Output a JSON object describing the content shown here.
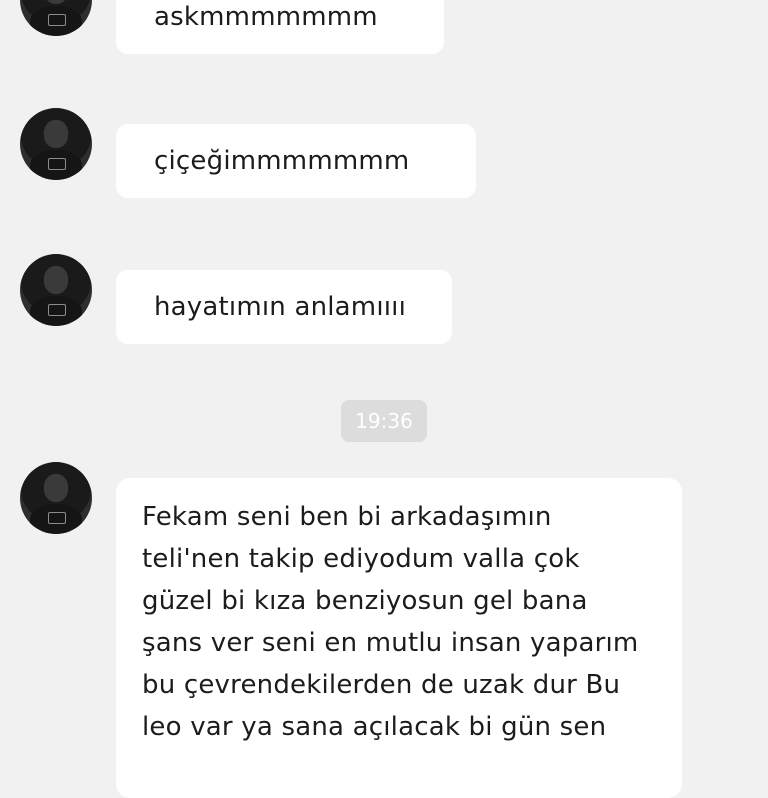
{
  "messages": [
    {
      "text": "askmmmmmmm"
    },
    {
      "text": "çiçeğimmmmmmm"
    },
    {
      "text": "hayatımın anlamıııı"
    },
    {
      "text": "Fekam seni ben bi arkadaşımın\nteli'nen takip ediyodum valla çok\ngüzel bi kıza benziyosun gel bana\nşans ver seni en mutlu insan yaparım\nbu çevrendekilerden de uzak dur Bu\nleo var ya sana açılacak bi gün sen"
    }
  ],
  "timestamp": "19:36",
  "colors": {
    "background": "#f1f1f1",
    "bubble": "#ffffff",
    "timestamp_badge": "#dcdcdc"
  },
  "icons": {
    "avatar": "profile-photo"
  }
}
